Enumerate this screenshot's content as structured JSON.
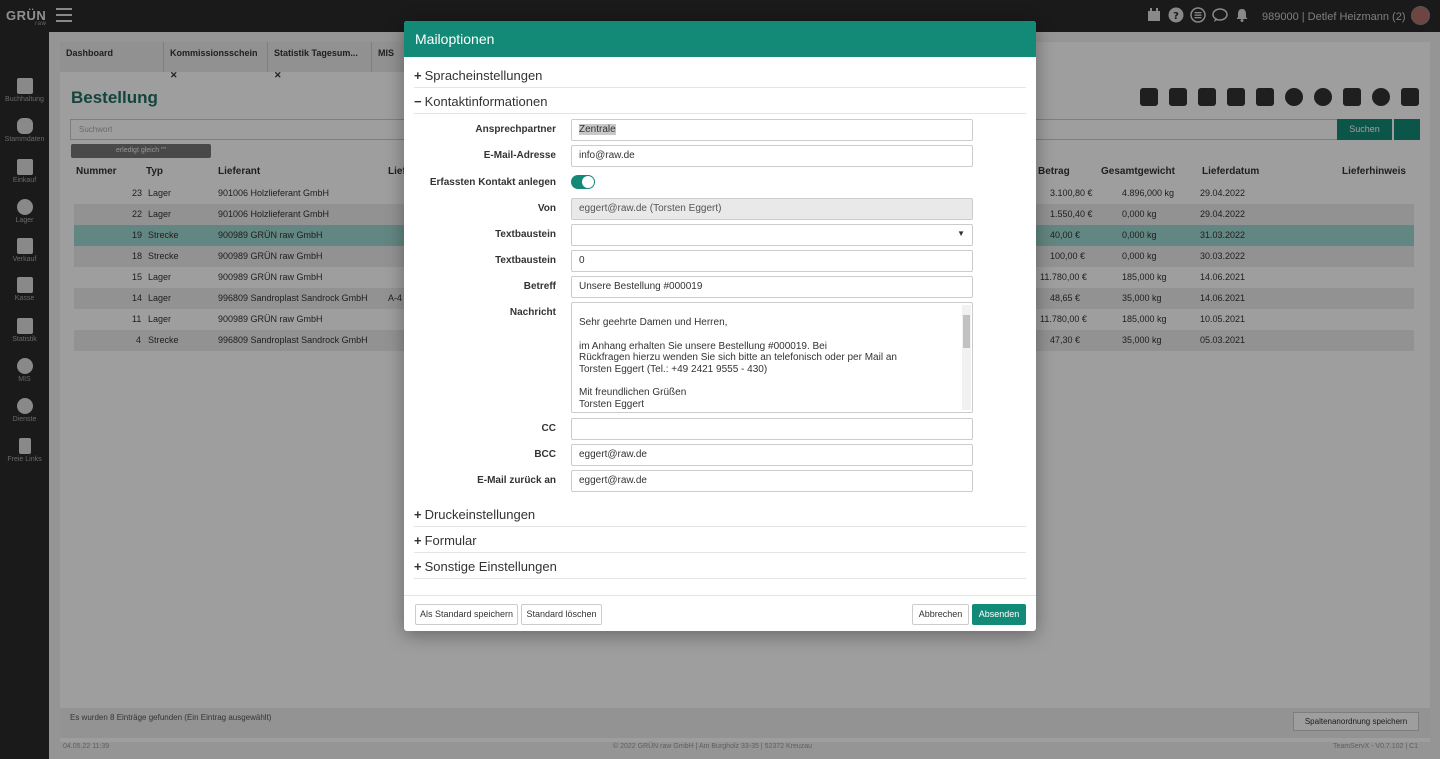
{
  "app": {
    "logo": "GRÜN",
    "logo_sub": "raw",
    "user": "989000 | Detlef Heizmann (2)",
    "user_chevron": "⌄"
  },
  "sidebar": {
    "items": [
      {
        "label": "Buchhaltung",
        "icon": "book-icon"
      },
      {
        "label": "Stammdaten",
        "icon": "database-icon"
      },
      {
        "label": "Einkauf",
        "icon": "cart-icon"
      },
      {
        "label": "Lager",
        "icon": "boxes-icon"
      },
      {
        "label": "Verkauf",
        "icon": "bag-icon"
      },
      {
        "label": "Kasse",
        "icon": "cash-register-icon"
      },
      {
        "label": "Statistik",
        "icon": "chart-icon"
      },
      {
        "label": "MIS",
        "icon": "pie-icon"
      },
      {
        "label": "Dienste",
        "icon": "info-icon"
      },
      {
        "label": "Freie Links",
        "icon": "bookmark-icon"
      }
    ]
  },
  "tabs": [
    {
      "label": "Dashboard"
    },
    {
      "label": "Kommissionsschein",
      "close": "✕"
    },
    {
      "label": "Statistik Tagesum...",
      "close": "✕"
    },
    {
      "label": "MIS"
    }
  ],
  "page": {
    "title": "Bestellung",
    "search_placeholder": "Suchwort",
    "search_button": "Suchen",
    "chip": "erledigt gleich \"\"",
    "columns": {
      "nummer": "Nummer",
      "typ": "Typ",
      "lieferant": "Lieferant",
      "lie": "Lief",
      "betrag": "Betrag",
      "gewicht": "Gesamtgewicht",
      "datum": "Lieferdatum",
      "hinweis": "Lieferhinweis"
    },
    "rows": [
      {
        "nummer": "23",
        "typ": "Lager",
        "lieferant": "901006 Holzlieferant GmbH",
        "extra": "",
        "betrag": "3.100,80 €",
        "gewicht": "4.896,000 kg",
        "datum": "29.04.2022"
      },
      {
        "nummer": "22",
        "typ": "Lager",
        "lieferant": "901006 Holzlieferant GmbH",
        "extra": "",
        "betrag": "1.550,40 €",
        "gewicht": "0,000 kg",
        "datum": "29.04.2022"
      },
      {
        "nummer": "19",
        "typ": "Strecke",
        "lieferant": "900989 GRÜN raw GmbH",
        "extra": "",
        "betrag": "40,00 €",
        "gewicht": "0,000 kg",
        "datum": "31.03.2022"
      },
      {
        "nummer": "18",
        "typ": "Strecke",
        "lieferant": "900989 GRÜN raw GmbH",
        "extra": "",
        "betrag": "100,00 €",
        "gewicht": "0,000 kg",
        "datum": "30.03.2022"
      },
      {
        "nummer": "15",
        "typ": "Lager",
        "lieferant": "900989 GRÜN raw GmbH",
        "extra": "",
        "betrag": "11.780,00 €",
        "gewicht": "185,000 kg",
        "datum": "14.06.2021"
      },
      {
        "nummer": "14",
        "typ": "Lager",
        "lieferant": "996809 Sandroplast Sandrock GmbH",
        "extra": "A-4",
        "betrag": "48,65 €",
        "gewicht": "35,000 kg",
        "datum": "14.06.2021"
      },
      {
        "nummer": "11",
        "typ": "Lager",
        "lieferant": "900989 GRÜN raw GmbH",
        "extra": "",
        "betrag": "11.780,00 €",
        "gewicht": "185,000 kg",
        "datum": "10.05.2021"
      },
      {
        "nummer": "4",
        "typ": "Strecke",
        "lieferant": "996809 Sandroplast Sandrock GmbH",
        "extra": "",
        "betrag": "47,30 €",
        "gewicht": "35,000 kg",
        "datum": "05.03.2021"
      }
    ],
    "status": "Es wurden 8 Einträge gefunden (Ein Eintrag ausgewählt)",
    "spalten_button": "Spaltenanordnung speichern"
  },
  "bottom": {
    "left": "04.05.22 11:39",
    "center": "© 2022 GRÜN raw GmbH | Am Burgholz 33-35 | 52372 Kreuzau",
    "right": "TeamServX - V0.7.102 | C1"
  },
  "modal": {
    "title": "Mailoptionen",
    "sections": {
      "sprache": {
        "sign": "+",
        "label": "Spracheinstellungen"
      },
      "kontakt": {
        "sign": "−",
        "label": "Kontaktinformationen"
      },
      "druck": {
        "sign": "+",
        "label": "Druckeinstellungen"
      },
      "formular": {
        "sign": "+",
        "label": "Formular"
      },
      "sonstige": {
        "sign": "+",
        "label": "Sonstige Einstellungen"
      }
    },
    "fields": {
      "ansprechpartner": {
        "label": "Ansprechpartner",
        "value": "Zentrale"
      },
      "email": {
        "label": "E-Mail-Adresse",
        "value": "info@raw.de"
      },
      "kontakt_anlegen": {
        "label": "Erfassten Kontakt anlegen",
        "checked": true
      },
      "von": {
        "label": "Von",
        "value": "eggert@raw.de (Torsten Eggert)"
      },
      "textbaustein1": {
        "label": "Textbaustein",
        "value": ""
      },
      "textbaustein2": {
        "label": "Textbaustein",
        "value": "0"
      },
      "betreff": {
        "label": "Betreff",
        "value": "Unsere Bestellung #000019"
      },
      "nachricht": {
        "label": "Nachricht",
        "lines": [
          "Sehr geehrte Damen und Herren,",
          "",
          "im Anhang erhalten Sie unsere Bestellung #000019. Bei",
          "Rückfragen hierzu wenden Sie sich bitte an telefonisch oder per Mail an",
          "Torsten Eggert (Tel.: +49 2421 9555 - 430)",
          "",
          "Mit freundlichen Grüßen",
          "Torsten Eggert"
        ]
      },
      "cc": {
        "label": "CC",
        "value": ""
      },
      "bcc": {
        "label": "BCC",
        "value": "eggert@raw.de"
      },
      "reply": {
        "label": "E-Mail zurück an",
        "value": "eggert@raw.de"
      }
    },
    "buttons": {
      "save_default": "Als Standard speichern",
      "delete_default": "Standard löschen",
      "cancel": "Abbrechen",
      "send": "Absenden"
    }
  }
}
